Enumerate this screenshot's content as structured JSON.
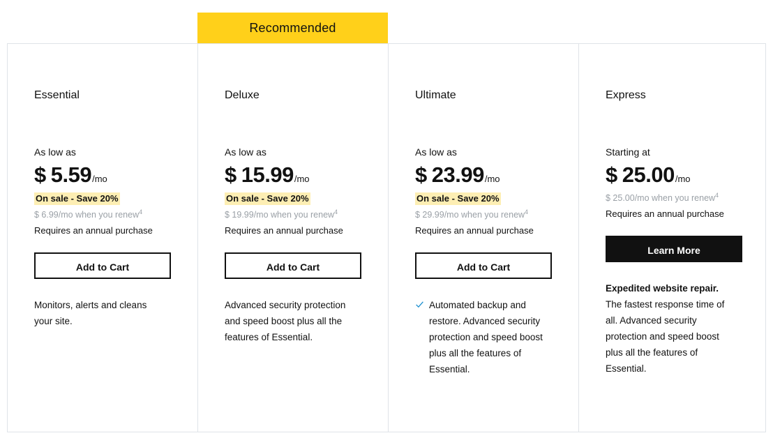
{
  "ribbon": {
    "label": "Recommended",
    "color": "#ffd01a",
    "attached_to": "Deluxe"
  },
  "style": {
    "sale_highlight": "#fdeeb3",
    "border": "#dfe3e8",
    "check_color": "#1a8ecf",
    "cta_solid_bg": "#111111"
  },
  "plans": [
    {
      "name": "Essential",
      "price_lead": "As low as",
      "currency": "$",
      "amount": "5.59",
      "period": "/mo",
      "sale_badge": "On sale - Save 20%",
      "renew_text": "$ 6.99/mo when you renew",
      "renew_footnote": "4",
      "requires": "Requires an annual purchase",
      "cta_label": "Add to Cart",
      "cta_style": "outline",
      "has_check": false,
      "desc_strong": "",
      "desc": "Monitors, alerts and cleans your site."
    },
    {
      "name": "Deluxe",
      "price_lead": "As low as",
      "currency": "$",
      "amount": "15.99",
      "period": "/mo",
      "sale_badge": "On sale - Save 20%",
      "renew_text": "$ 19.99/mo when you renew",
      "renew_footnote": "4",
      "requires": "Requires an annual purchase",
      "cta_label": "Add to Cart",
      "cta_style": "outline",
      "has_check": false,
      "desc_strong": "",
      "desc": "Advanced security protection and speed boost plus all the features of Essential."
    },
    {
      "name": "Ultimate",
      "price_lead": "As low as",
      "currency": "$",
      "amount": "23.99",
      "period": "/mo",
      "sale_badge": "On sale - Save 20%",
      "renew_text": "$ 29.99/mo when you renew",
      "renew_footnote": "4",
      "requires": "Requires an annual purchase",
      "cta_label": "Add to Cart",
      "cta_style": "outline",
      "has_check": true,
      "desc_strong": "",
      "desc": "Automated backup and restore. Advanced security protection and speed boost plus all the features of Essential."
    },
    {
      "name": "Express",
      "price_lead": "Starting at",
      "currency": "$",
      "amount": "25.00",
      "period": "/mo",
      "sale_badge": "",
      "renew_text": "$ 25.00/mo when you renew",
      "renew_footnote": "4",
      "requires": "Requires an annual purchase",
      "cta_label": "Learn More",
      "cta_style": "solid",
      "has_check": false,
      "desc_strong": "Expedited website repair.",
      "desc": " The fastest response time of all. Advanced security protection and speed boost plus all the features of Essential."
    }
  ]
}
